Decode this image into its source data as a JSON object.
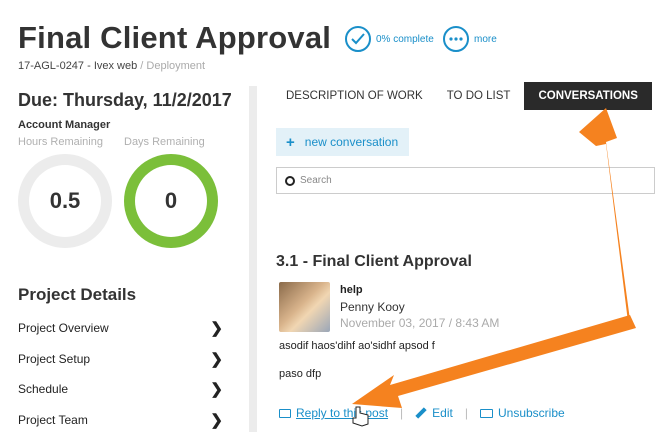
{
  "header": {
    "title": "Final Client Approval",
    "status_label": "0% complete",
    "more_label": "more",
    "project_code": "17-AGL-0247 - Ivex web",
    "breadcrumb_sep": " / ",
    "phase": "Deployment"
  },
  "sidebar": {
    "due": "Due: Thursday, 11/2/2017",
    "account_manager": "Account Manager",
    "hours_label": "Hours Remaining",
    "days_label": "Days Remaining",
    "hours_value": "0.5",
    "days_value": "0",
    "details_title": "Project Details",
    "items": [
      {
        "label": "Project Overview"
      },
      {
        "label": "Project Setup"
      },
      {
        "label": "Schedule"
      },
      {
        "label": "Project Team"
      }
    ]
  },
  "tabs": [
    {
      "label": "DESCRIPTION OF WORK"
    },
    {
      "label": "TO DO LIST"
    },
    {
      "label": "CONVERSATIONS"
    }
  ],
  "conversations": {
    "new_label": "new conversation",
    "search_placeholder": "Search",
    "thread_title": "3.1 - Final Client Approval",
    "post": {
      "subject": "help",
      "author": "Penny Kooy",
      "date": "November 03, 2017 / 8:43 AM",
      "lines": [
        "asodif haos'dihf ao'sidhf apsod f",
        "paso dfp"
      ]
    },
    "actions": {
      "reply": "Reply to this post",
      "edit": "Edit",
      "unsubscribe": "Unsubscribe"
    }
  },
  "colors": {
    "accent": "#1a8fc9",
    "gauge_green": "#7bbf3a",
    "annotation_arrow": "#f5821f"
  }
}
